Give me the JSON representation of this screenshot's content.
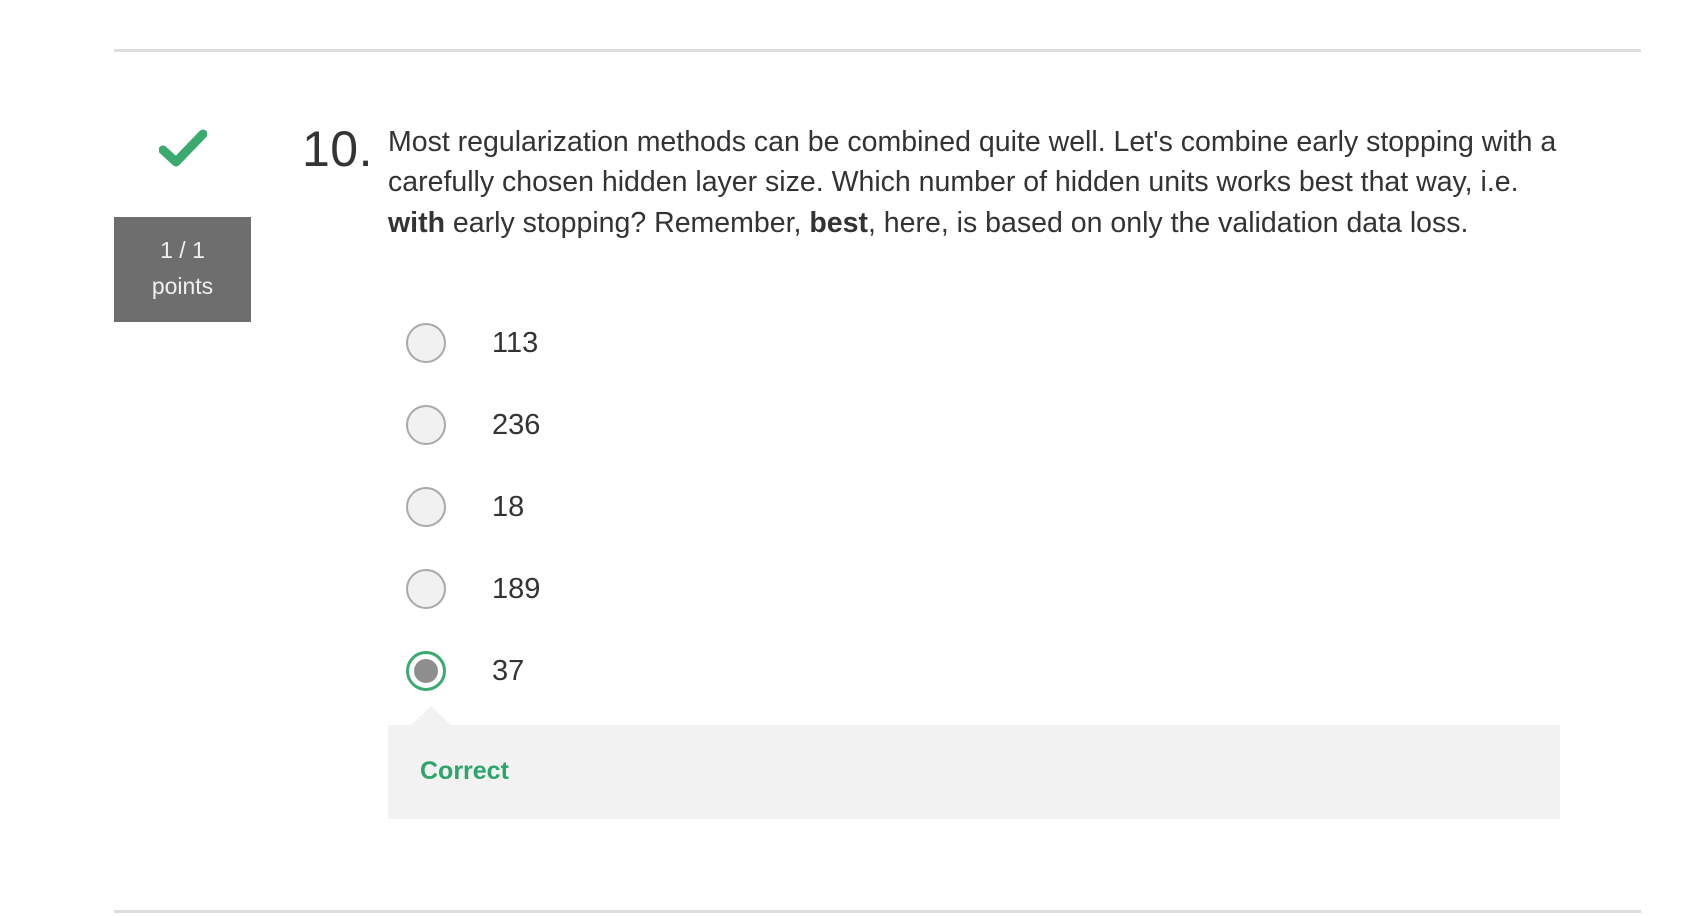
{
  "question": {
    "number": "10.",
    "text_parts": [
      "Most regularization methods can be combined quite well. Let's combine early stopping with a carefully chosen hidden layer size. Which number of hidden units works best that way, i.e. ",
      "with",
      " early stopping? Remember, ",
      "best",
      ", here, is based on only the validation data loss."
    ],
    "status_icon": "checkmark-icon",
    "status_color": "#3aaa6e",
    "score": "1 / 1",
    "score_unit": "points"
  },
  "options": [
    {
      "label": "113",
      "selected": false
    },
    {
      "label": "236",
      "selected": false
    },
    {
      "label": "18",
      "selected": false
    },
    {
      "label": "189",
      "selected": false
    },
    {
      "label": "37",
      "selected": true
    }
  ],
  "feedback": {
    "text": "Correct",
    "color": "#2fa46a"
  }
}
